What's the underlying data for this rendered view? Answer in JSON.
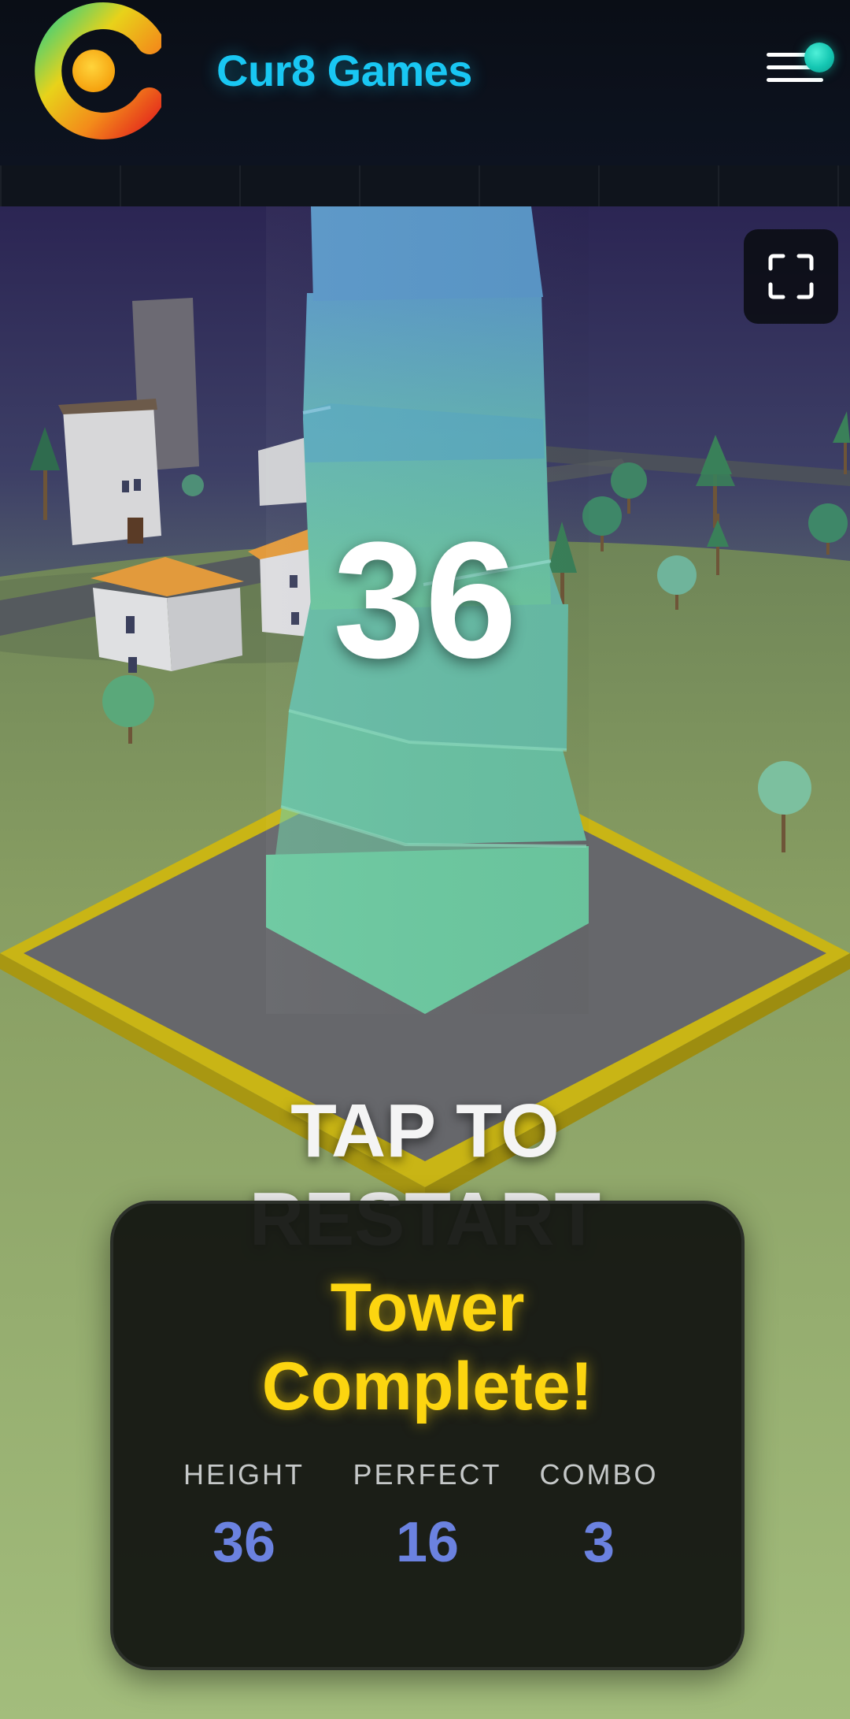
{
  "header": {
    "brand": "Cur8 Games",
    "logo_icon": "cur8-logo-icon",
    "menu_icon": "hamburger-menu-icon",
    "notification_dot_color": "#14c6b2",
    "brand_color": "#19c7f3"
  },
  "game": {
    "score": "36",
    "restart_line1": "TAP TO",
    "restart_line2": "RESTART",
    "fullscreen_icon": "fullscreen-icon"
  },
  "result": {
    "title_line1": "Tower",
    "title_line2": "Complete!",
    "title_color": "#fcd510",
    "value_color": "#6b82e0",
    "stats": [
      {
        "label": "HEIGHT",
        "value": "36"
      },
      {
        "label": "PERFECT",
        "value": "16"
      },
      {
        "label": "COMBO",
        "value": "3"
      }
    ]
  }
}
